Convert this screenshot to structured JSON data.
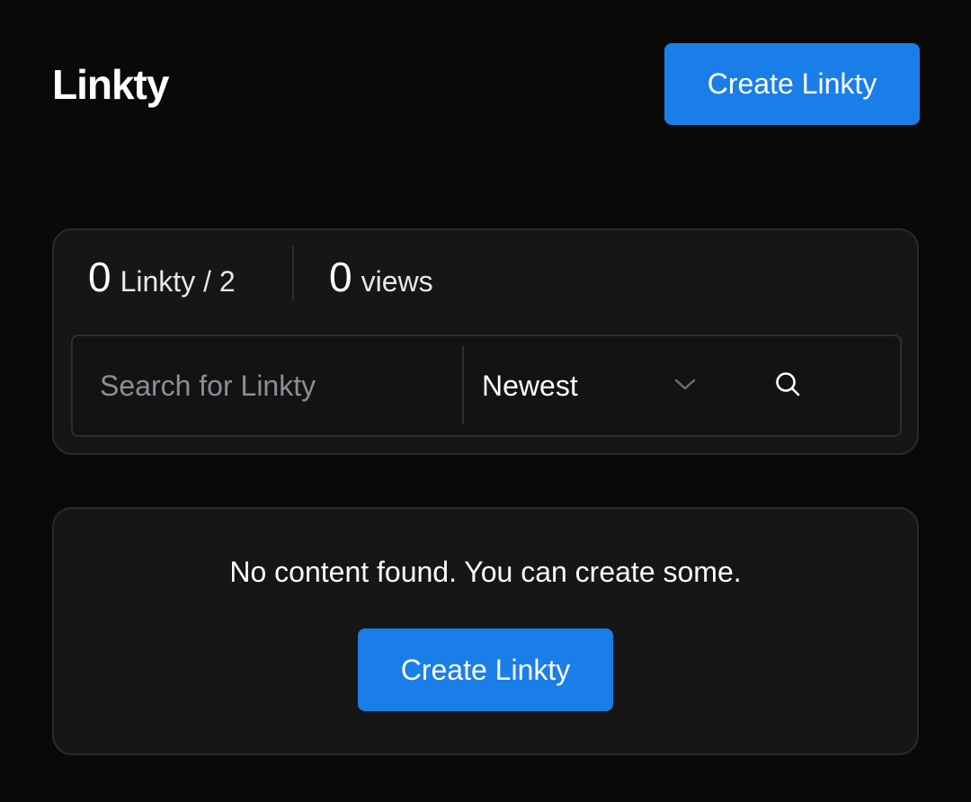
{
  "header": {
    "title": "Linkty",
    "create_button_label": "Create Linkty"
  },
  "stats": {
    "linkty_count": "0",
    "linkty_label": "Linkty / 2",
    "views_count": "0",
    "views_label": "views"
  },
  "search": {
    "placeholder": "Search for Linkty",
    "value": "",
    "sort_selected": "Newest",
    "icons": {
      "sort": "chevron-down-icon",
      "submit": "search-icon"
    }
  },
  "empty_state": {
    "message": "No content found. You can create some.",
    "create_button_label": "Create Linkty"
  },
  "colors": {
    "background": "#0a0908",
    "card": "#161616",
    "accent": "#1a7ee8",
    "muted_text": "#8a8f96"
  }
}
